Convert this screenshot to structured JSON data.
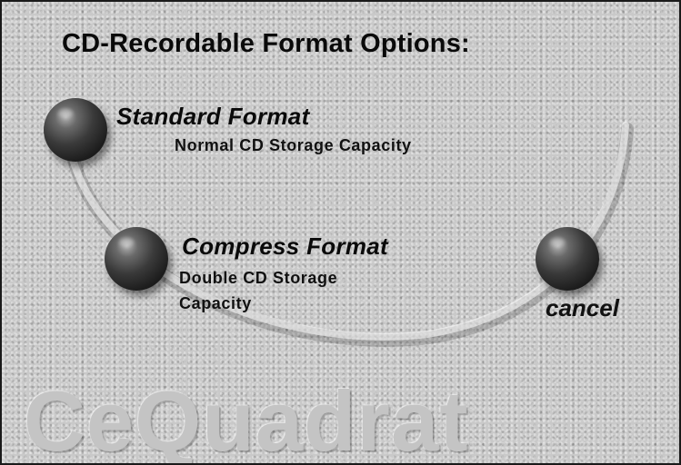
{
  "dialog": {
    "title": "CD-Recordable Format Options:"
  },
  "options": [
    {
      "title": "Standard Format",
      "description_lines": [
        "Normal CD Storage Capacity"
      ]
    },
    {
      "title": "Compress Format",
      "description_lines": [
        "Double CD Storage",
        "Capacity"
      ]
    }
  ],
  "cancel": {
    "label": "cancel"
  },
  "brand": {
    "logo_text": "CeQuadrat"
  },
  "colors": {
    "background": "#c9c9c9",
    "text": "#0a0a0a",
    "button": "#2a2a2a"
  }
}
